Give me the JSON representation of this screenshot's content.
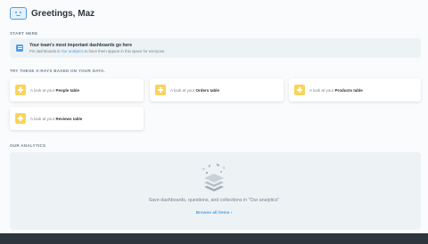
{
  "header": {
    "greeting": "Greetings, Maz"
  },
  "start_here": {
    "label": "START HERE",
    "card_title": "Your team's most important dashboards go here",
    "card_sub_prefix": "Pin dashboards in ",
    "card_sub_link": "Our analytics",
    "card_sub_suffix": " to have them appear in this space for everyone"
  },
  "xrays": {
    "label": "TRY THESE X-RAYS BASED ON YOUR DATA.",
    "items": [
      {
        "prefix": "A look at your ",
        "table": "People table"
      },
      {
        "prefix": "A look at your ",
        "table": "Orders table"
      },
      {
        "prefix": "A look at your ",
        "table": "Products table"
      },
      {
        "prefix": "A look at your ",
        "table": "Reviews table"
      }
    ]
  },
  "analytics": {
    "label": "OUR ANALYTICS",
    "empty_message": "Save dashboards, questions, and collections in \"Our analytics\"",
    "browse_label": "Browse all items",
    "browse_chevron": "›"
  }
}
